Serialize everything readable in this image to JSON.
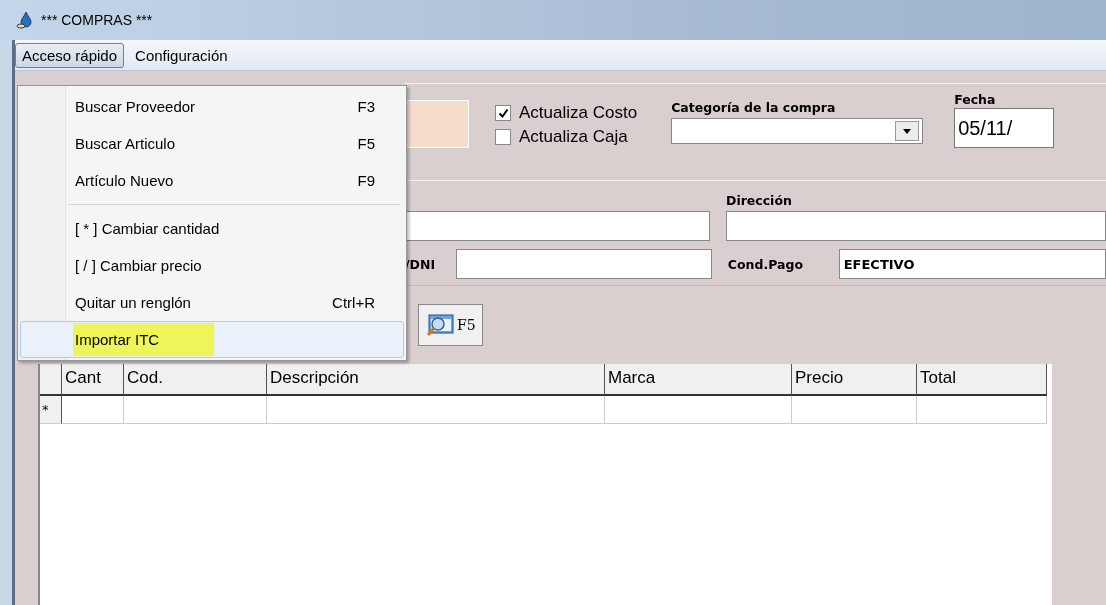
{
  "window": {
    "title": "*** COMPRAS ***"
  },
  "menu_bar": [
    {
      "label": "Acceso rápido",
      "selected": true
    },
    {
      "label": "Configuración",
      "selected": false
    }
  ],
  "dropdown": {
    "groups": [
      [
        {
          "label": "Buscar Proveedor",
          "shortcut": "F3",
          "selected": false
        },
        {
          "label": "Buscar Articulo",
          "shortcut": "F5",
          "selected": false
        },
        {
          "label": "Artículo Nuevo",
          "shortcut": "F9",
          "selected": false
        }
      ],
      [
        {
          "label": "[ * ]  Cambiar cantidad",
          "selected": false
        },
        {
          "label": "[ / ]  Cambiar precio",
          "selected": false
        },
        {
          "label": "Quitar un renglón",
          "shortcut": "Ctrl+R",
          "selected": false
        },
        {
          "label": "Importar ITC",
          "selected": true
        }
      ]
    ]
  },
  "options": [
    {
      "label": "Actualiza Costo",
      "checked": true
    },
    {
      "label": "Actualiza Caja",
      "checked": false
    }
  ],
  "category": {
    "label": "Categoría de la compra"
  },
  "date": {
    "label": "Fecha",
    "value": "05/11/"
  },
  "address": {
    "label": "Dirección"
  },
  "id_field": {
    "label": "/DNI"
  },
  "payment": {
    "label": "Cond.Pago",
    "value": "EFECTIVO"
  },
  "toolbar": {
    "search_button": "F5"
  },
  "table": {
    "columns": [
      "",
      "Cant",
      "Cod.",
      "Descripción",
      "Marca",
      "Precio",
      "Total"
    ],
    "new_row_marker": "*"
  }
}
